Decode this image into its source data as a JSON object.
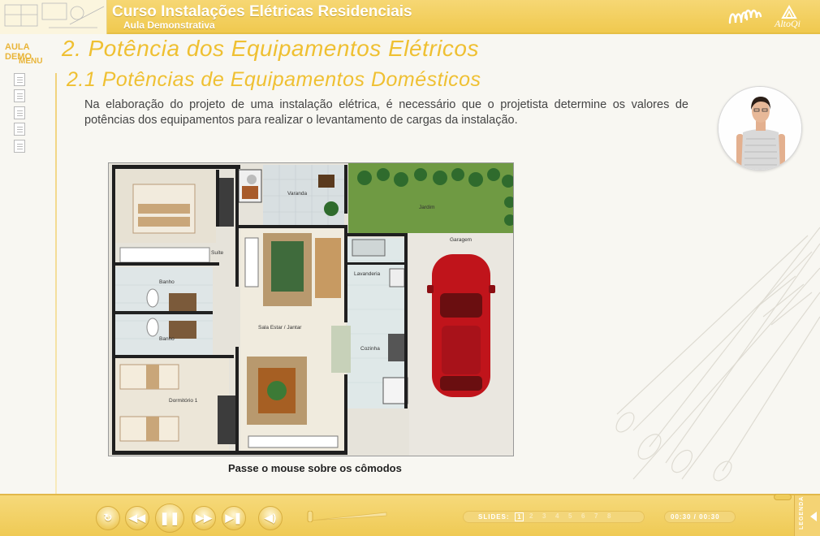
{
  "header": {
    "title": "Curso Instalações Elétricas Residenciais",
    "subtitle": "Aula Demonstrativa",
    "logo_right": "AltoQi",
    "logo_mm_icon": "mm-logo-icon"
  },
  "sidebar": {
    "aula_demo": "AULA DEMO",
    "menu": "MENU",
    "items": [
      {
        "icon": "document-icon"
      },
      {
        "icon": "document-icon"
      },
      {
        "icon": "document-icon"
      },
      {
        "icon": "document-icon"
      },
      {
        "icon": "document-icon"
      }
    ]
  },
  "main": {
    "section_title": "2. Potência dos Equipamentos Elétricos",
    "subsection_title": "2.1 Potências de Equipamentos Domésticos",
    "paragraph": "Na elaboração do projeto de uma instalação elétrica, é necessário que o projetista determine os valores de potências dos equipamentos para realizar o levantamento de cargas da instalação.",
    "caption": "Passe o mouse sobre os cômodos"
  },
  "floor_plan": {
    "rooms": {
      "varanda": "Varanda",
      "jardim": "Jardim",
      "garagem": "Garagem",
      "suite": "Suíte",
      "banho1": "Banho",
      "banho2": "Banho",
      "lavanderia": "Lavanderia",
      "sala": "Sala Estar / Jantar",
      "cozinha": "Cozinha",
      "dormitorio": "Dormitório 1"
    }
  },
  "player": {
    "controls": [
      {
        "name": "replay-button",
        "icon": "replay-icon",
        "glyph": "↻"
      },
      {
        "name": "rewind-button",
        "icon": "rewind-icon",
        "glyph": "◀◀"
      },
      {
        "name": "pause-button",
        "icon": "pause-icon",
        "glyph": "❚❚"
      },
      {
        "name": "forward-button",
        "icon": "fast-forward-icon",
        "glyph": "▶▶"
      },
      {
        "name": "next-button",
        "icon": "skip-next-icon",
        "glyph": "▶❚"
      },
      {
        "name": "volume-button",
        "icon": "speaker-icon",
        "glyph": "◀)"
      }
    ],
    "slides_label": "SLIDES:",
    "current_slide": "1",
    "other_slides": [
      "2",
      "3",
      "4",
      "5",
      "6",
      "7",
      "8"
    ],
    "time": "00:30 / 00:30",
    "legenda": "LEGENDA"
  },
  "colors": {
    "accent": "#efc032",
    "header_bg": "#f0c94f"
  }
}
